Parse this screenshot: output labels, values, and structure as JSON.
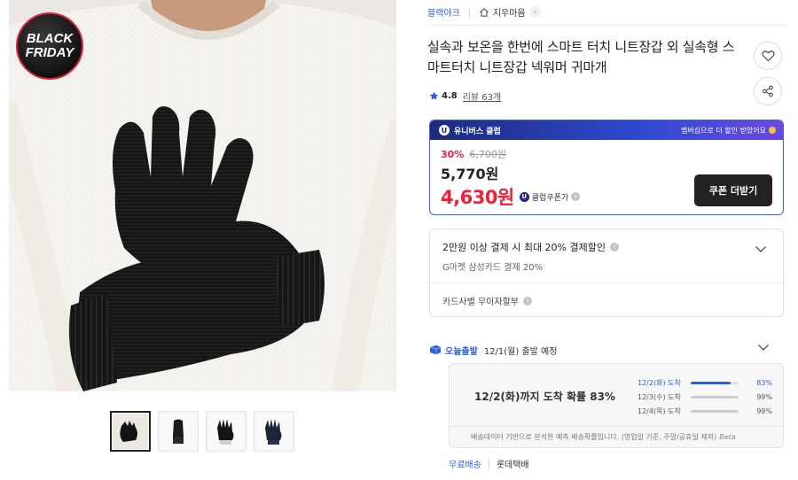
{
  "product_image": {
    "sale_badge": [
      "BLACK",
      "FRIDAY"
    ],
    "thumbnails": [
      "thumbnail-1",
      "thumbnail-2",
      "thumbnail-3",
      "thumbnail-4"
    ]
  },
  "header": {
    "brand": "블랙야크",
    "shop_name": "지우마음"
  },
  "product": {
    "title": "실속과 보온을 한번에 스마트 터치 니트장갑 외 실속형 스마트터치 니트장갑 넥워머 귀마개",
    "rating": "4.8",
    "review_label": "리뷰 63개"
  },
  "price": {
    "club_badge": "유니버스 클럽",
    "club_note": "멤버십으로 더 할인 받았어요",
    "discount_rate": "30%",
    "original_price": "6,700원",
    "sale_price": "5,770원",
    "club_price": "4,630원",
    "club_price_label": "클럽쿠폰가",
    "coupon_button": "쿠폰 더받기"
  },
  "benefits": {
    "main": "2만원 이상 결제 시 최대 20% 결제할인",
    "sub": "G마켓 삼성카드 결제 20%",
    "installment": "카드사별 무이자할부"
  },
  "delivery": {
    "badge": "오늘출발",
    "departure": "12/1(월) 출발 예정",
    "forecast_headline": "12/2(화)까지 도착 확률 83%",
    "forecast": [
      {
        "date": "12/2(화) 도착",
        "percent_label": "83%",
        "percent": 83
      },
      {
        "date": "12/3(수) 도착",
        "percent_label": "99%",
        "percent": 99
      },
      {
        "date": "12/4(목) 도착",
        "percent_label": "99%",
        "percent": 99
      }
    ],
    "note": "배송데이터 기반으로 분석한 예측 배송확률입니다. (영업일 기준, 주말/공휴일 제외)",
    "note_tag": "Beta",
    "free_shipping": "무료배송",
    "carrier": "롯데택배"
  },
  "colors": {
    "accent_blue": "#2b5fd9",
    "sale_red": "#f0213a",
    "club_navy": "#1d2a7c"
  },
  "icons": [
    "heart-icon",
    "share-icon",
    "home-icon",
    "star-icon",
    "chevron-down-icon",
    "info-icon",
    "truck-icon"
  ]
}
